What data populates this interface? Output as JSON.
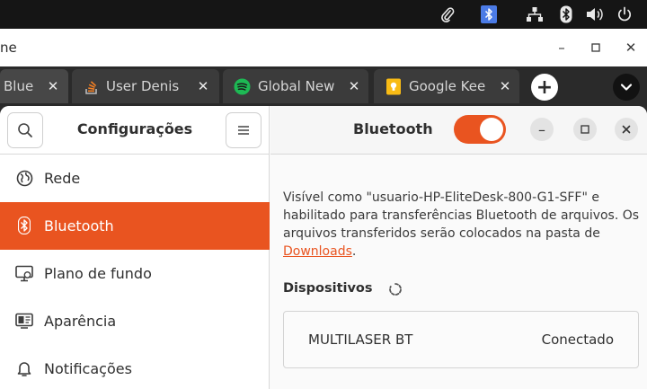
{
  "colors": {
    "accent": "#e95420",
    "topbar": "#151515",
    "tabstrip": "#2a2a2a",
    "spotify_green": "#1db954",
    "keep_yellow": "#f8bb15"
  },
  "system_tray": {
    "icons": [
      "paperclip-icon",
      "bluetooth-indicator-icon",
      "network-icon",
      "bluetooth-icon",
      "volume-icon",
      "power-icon"
    ]
  },
  "browser": {
    "window_title_fragment": "ne",
    "window_controls": {
      "minimize": "–",
      "maximize": "▫",
      "close": "✕"
    },
    "tabs": [
      {
        "label": "Blue",
        "icon": "none",
        "close": "✕",
        "active": true
      },
      {
        "label": "User Denis",
        "icon": "stackoverflow-icon",
        "close": "✕"
      },
      {
        "label": "Global New",
        "icon": "spotify-icon",
        "close": "✕"
      },
      {
        "label": "Google Kee",
        "icon": "google-keep-icon",
        "close": "✕"
      }
    ],
    "new_tab": "+",
    "tab_list_icon": "chevron-down-icon"
  },
  "settings": {
    "sidebar": {
      "title": "Configurações",
      "search_icon": "search-icon",
      "menu_icon": "hamburger-icon",
      "items": [
        {
          "label": "Rede",
          "icon": "globe-icon"
        },
        {
          "label": "Bluetooth",
          "icon": "bluetooth-icon",
          "active": true
        },
        {
          "label": "Plano de fundo",
          "icon": "monitor-icon"
        },
        {
          "label": "Aparência",
          "icon": "appearance-icon"
        },
        {
          "label": "Notificações",
          "icon": "bell-icon"
        }
      ]
    },
    "main": {
      "title": "Bluetooth",
      "bluetooth_enabled": true,
      "window_buttons": {
        "minimize": "–",
        "maximize": "□",
        "close": "✕"
      },
      "description_text": "Visível como \"usuario-HP-EliteDesk-800-G1-SFF\" e habilitado para transferências Bluetooth de arquivos. Os arquivos transferidos serão colocados na pasta de ",
      "description_link": "Downloads",
      "description_end": ".",
      "devices_title": "Dispositivos",
      "devices": [
        {
          "name": "MULTILASER BT",
          "status": "Conectado"
        }
      ]
    }
  }
}
